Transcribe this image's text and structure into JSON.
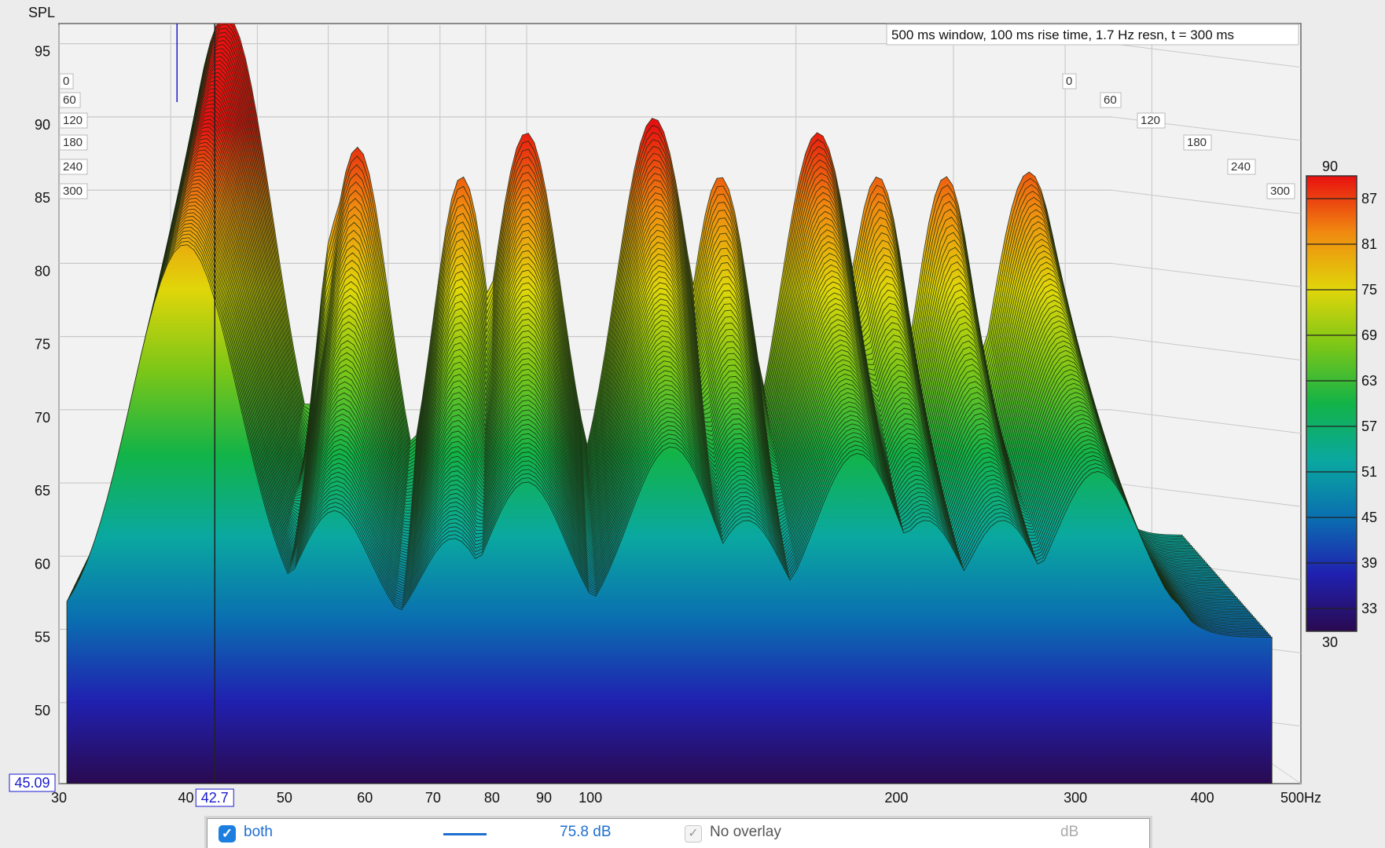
{
  "chart_data": {
    "type": "waterfall",
    "title": "500 ms window, 100 ms rise time,  1.7 Hz resn, t = 300 ms",
    "ylabel": "SPL",
    "x_unit_suffix": "Hz",
    "ylim": [
      45,
      96
    ],
    "xlim": [
      30,
      500
    ],
    "x_scale": "log",
    "y_ticks": [
      95,
      90,
      85,
      80,
      75,
      70,
      65,
      60,
      55,
      50
    ],
    "x_ticks": [
      30,
      40,
      50,
      60,
      70,
      80,
      90,
      100,
      200,
      300,
      400,
      500
    ],
    "time_slices_ms": [
      0,
      60,
      120,
      180,
      240,
      300
    ],
    "cursor": {
      "frequency": "42.7",
      "level": "45.09",
      "marker_frequency": 39.2
    },
    "colorbar": {
      "min": "30",
      "max": "90",
      "ticks": [
        87,
        81,
        75,
        69,
        63,
        57,
        51,
        45,
        39,
        33
      ],
      "colors": [
        "#2a0a50",
        "#2020b0",
        "#0a6fb0",
        "#0aa8a0",
        "#12b348",
        "#7ac618",
        "#e0d60a",
        "#f08a10",
        "#e81010"
      ]
    },
    "series": [
      {
        "name": "both",
        "peaks": [
          {
            "freq": 39.2,
            "spl": 90.5,
            "width": 0.075
          },
          {
            "freq": 55,
            "spl": 81.5,
            "width": 0.05
          },
          {
            "freq": 52,
            "spl": 76.5,
            "width": 0.03
          },
          {
            "freq": 72,
            "spl": 79.5,
            "width": 0.045
          },
          {
            "freq": 85,
            "spl": 82.5,
            "width": 0.055
          },
          {
            "freq": 118,
            "spl": 83.5,
            "width": 0.06
          },
          {
            "freq": 140,
            "spl": 79.5,
            "width": 0.05
          },
          {
            "freq": 180,
            "spl": 82.5,
            "width": 0.06
          },
          {
            "freq": 210,
            "spl": 79.5,
            "width": 0.05
          },
          {
            "freq": 250,
            "spl": 79.5,
            "width": 0.05
          },
          {
            "freq": 310,
            "spl": 79.8,
            "width": 0.06
          }
        ]
      }
    ]
  },
  "legend": {
    "series_label": "both",
    "value": "75.8 dB",
    "overlay_label": "No overlay",
    "unit": "dB",
    "checkmark": "✓"
  }
}
